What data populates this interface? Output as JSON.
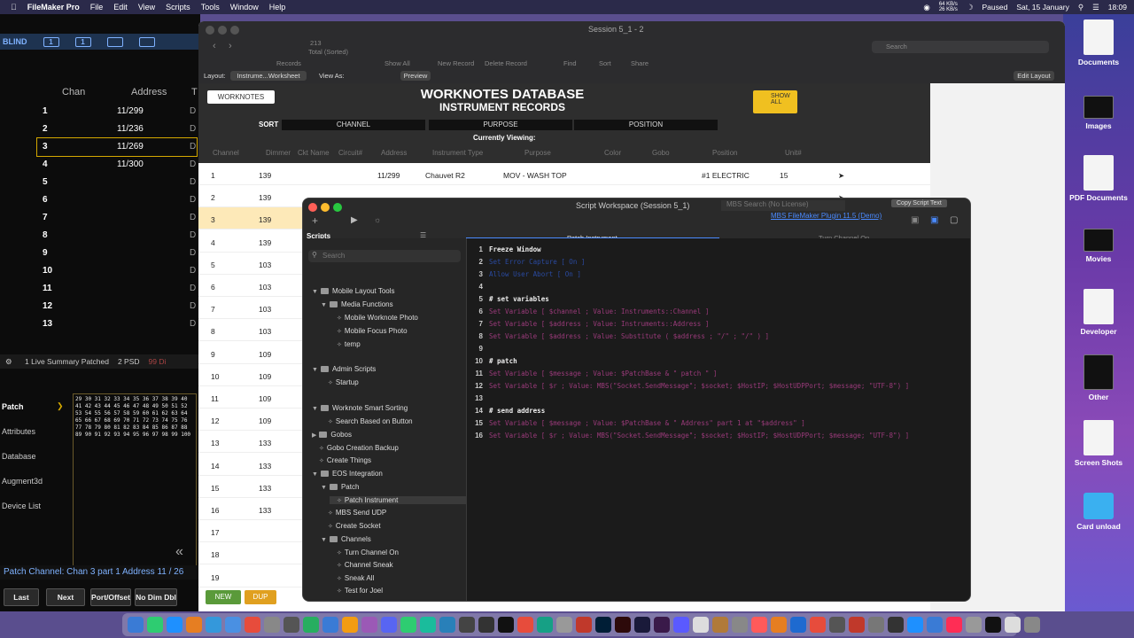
{
  "menubar": {
    "items": [
      "FileMaker Pro",
      "File",
      "Edit",
      "View",
      "Scripts",
      "Tools",
      "Window",
      "Help"
    ],
    "net": "64 KB/s\n26 KB/s",
    "status": "Paused",
    "date": "Sat, 15 January",
    "time": "18:09"
  },
  "desktop": {
    "icons": [
      "Documents",
      "Images",
      "PDF Documents",
      "Movies",
      "Developer",
      "Other",
      "Screen Shots",
      "Card unload"
    ]
  },
  "eos": {
    "mode": "BLIND",
    "blind_buttons": [
      "1",
      "1",
      "",
      ""
    ],
    "col_chan": "Chan",
    "col_address": "Address",
    "col_t": "T",
    "rows": [
      {
        "chan": "1",
        "addr": "11/299"
      },
      {
        "chan": "2",
        "addr": "11/236"
      },
      {
        "chan": "3",
        "addr": "11/269"
      },
      {
        "chan": "4",
        "addr": "11/300"
      },
      {
        "chan": "5",
        "addr": ""
      },
      {
        "chan": "6",
        "addr": ""
      },
      {
        "chan": "7",
        "addr": ""
      },
      {
        "chan": "8",
        "addr": ""
      },
      {
        "chan": "9",
        "addr": ""
      },
      {
        "chan": "10",
        "addr": ""
      },
      {
        "chan": "11",
        "addr": ""
      },
      {
        "chan": "12",
        "addr": ""
      },
      {
        "chan": "13",
        "addr": ""
      }
    ],
    "summary": [
      "1 Live Summary Patched",
      "2 PSD",
      "99 Di"
    ],
    "side_items": [
      "Patch",
      "Attributes",
      "Database",
      "Augment3d",
      "Device List"
    ],
    "command_line": "Patch Channel:  Chan 3 part 1 Address 11 / 26",
    "buttons": [
      "Last",
      "Next",
      "Port/Offset",
      "No Dim Dbl"
    ]
  },
  "fm": {
    "window_title": "Session 5_1 - 2",
    "records": "213",
    "records_sub": "Total (Sorted)",
    "records_label": "Records",
    "toolbar": [
      "Show All",
      "New Record",
      "Delete Record",
      "Find",
      "Sort",
      "Share"
    ],
    "search_placeholder": "Search",
    "layout_label": "Layout:",
    "layout_value": "Instrume...Worksheet",
    "view_as": "View As:",
    "preview": "Preview",
    "edit_layout": "Edit Layout",
    "worknotes_btn": "WORKNOTES",
    "db_title": "WORKNOTES DATABASE",
    "db_subtitle": "INSTRUMENT RECORDS",
    "show_all": "SHOW ALL",
    "sort": "SORT",
    "sort_tabs": [
      "CHANNEL",
      "PURPOSE",
      "POSITION"
    ],
    "currently_viewing": "Currently Viewing:",
    "columns": [
      "Channel",
      "Dimmer",
      "Ckt Name",
      "Circuit#",
      "Address",
      "Instrument Type",
      "Purpose",
      "Color",
      "Gobo",
      "Position",
      "Unit#"
    ],
    "records_list": [
      {
        "ch": "1",
        "dim": "139",
        "addr": "11/299",
        "type": "Chauvet R2",
        "purpose": "MOV - WASH TOP",
        "pos": "#1 ELECTRIC",
        "unit": "15"
      },
      {
        "ch": "2",
        "dim": "139",
        "addr": "",
        "type": "",
        "purpose": "",
        "pos": "",
        "unit": ""
      },
      {
        "ch": "3",
        "dim": "139",
        "addr": "",
        "type": "",
        "purpose": "",
        "pos": "",
        "unit": ""
      },
      {
        "ch": "4",
        "dim": "139"
      },
      {
        "ch": "5",
        "dim": "103"
      },
      {
        "ch": "6",
        "dim": "103"
      },
      {
        "ch": "7",
        "dim": "103"
      },
      {
        "ch": "8",
        "dim": "103"
      },
      {
        "ch": "9",
        "dim": "109"
      },
      {
        "ch": "10",
        "dim": "109"
      },
      {
        "ch": "11",
        "dim": "109"
      },
      {
        "ch": "12",
        "dim": "109"
      },
      {
        "ch": "13",
        "dim": "133"
      },
      {
        "ch": "14",
        "dim": "133"
      },
      {
        "ch": "15",
        "dim": "133"
      },
      {
        "ch": "16",
        "dim": "133"
      },
      {
        "ch": "17",
        "dim": ""
      },
      {
        "ch": "18",
        "dim": ""
      },
      {
        "ch": "19",
        "dim": ""
      }
    ],
    "new_btn": "NEW",
    "dup_btn": "DUP"
  },
  "sw": {
    "title": "Script Workspace (Session 5_1)",
    "mbs_search": "MBS Search (No License)",
    "copy_btn": "Copy Script Text",
    "mbs_plugin": "MBS FileMaker Plugin 11.5 (Demo)",
    "scripts_label": "Scripts",
    "search_placeholder": "Search",
    "tab_active": "Patch Instrument",
    "tab_other": "Turn Channel On",
    "tree": [
      {
        "label": "Mobile Layout Tools",
        "lvl": 0,
        "folder": true,
        "open": true
      },
      {
        "label": "Media Functions",
        "lvl": 1,
        "folder": true,
        "open": true
      },
      {
        "label": "Mobile Worknote Photo",
        "lvl": 2
      },
      {
        "label": "Mobile Focus Photo",
        "lvl": 2
      },
      {
        "label": "temp",
        "lvl": 2
      },
      {
        "label": "Admin Scripts",
        "lvl": 0,
        "folder": true,
        "open": true,
        "gap": true
      },
      {
        "label": "Startup",
        "lvl": 1
      },
      {
        "label": "Worknote Smart Sorting",
        "lvl": 0,
        "folder": true,
        "open": true,
        "gap": true
      },
      {
        "label": "Search Based on Button",
        "lvl": 1
      },
      {
        "label": "Gobos",
        "lvl": 0,
        "folder": true
      },
      {
        "label": "Gobo Creation Backup",
        "lvl": 0
      },
      {
        "label": "Create Things",
        "lvl": 0
      },
      {
        "label": "EOS Integration",
        "lvl": 0,
        "folder": true,
        "open": true
      },
      {
        "label": "Patch",
        "lvl": 1,
        "folder": true,
        "open": true
      },
      {
        "label": "Patch Instrument",
        "lvl": 2,
        "sel": true
      },
      {
        "label": "MBS Send UDP",
        "lvl": 1
      },
      {
        "label": "Create Socket",
        "lvl": 1
      },
      {
        "label": "Channels",
        "lvl": 1,
        "folder": true,
        "open": true
      },
      {
        "label": "Turn Channel On",
        "lvl": 2
      },
      {
        "label": "Channel Sneak",
        "lvl": 2
      },
      {
        "label": "Sneak All",
        "lvl": 2
      },
      {
        "label": "Test for Joel",
        "lvl": 2
      },
      {
        "label": "AV Capture Scripts",
        "lvl": 0,
        "folder": true
      }
    ],
    "code": [
      {
        "n": "1",
        "t": "Freeze Window",
        "k": "cm"
      },
      {
        "n": "2",
        "t": "Set Error Capture [ On ]",
        "k": "bl"
      },
      {
        "n": "3",
        "t": "Allow User Abort [ On ]",
        "k": "bl"
      },
      {
        "n": "4",
        "t": "",
        "k": "cm"
      },
      {
        "n": "5",
        "t": "# set variables",
        "k": "cm"
      },
      {
        "n": "6",
        "t": "Set Variable [ $channel ; Value: Instruments::Channel ]",
        "k": "st"
      },
      {
        "n": "7",
        "t": "Set Variable [ $address ; Value: Instruments::Address ]",
        "k": "st"
      },
      {
        "n": "8",
        "t": "Set Variable [ $address ; Value: Substitute ( $address ; \"/\" ; \"/\" ) ]",
        "k": "st"
      },
      {
        "n": "9",
        "t": "",
        "k": "cm"
      },
      {
        "n": "10",
        "t": "# patch",
        "k": "cm"
      },
      {
        "n": "11",
        "t": "Set Variable [ $message ; Value: $PatchBase & \" patch \" ]",
        "k": "st"
      },
      {
        "n": "12",
        "t": "Set Variable [ $r ; Value: MBS(\"Socket.SendMessage\"; $socket; $HostIP; $HostUDPPort; $message; \"UTF-8\") ]",
        "k": "st"
      },
      {
        "n": "13",
        "t": "",
        "k": "cm"
      },
      {
        "n": "14",
        "t": "# send address",
        "k": "cm"
      },
      {
        "n": "15",
        "t": "Set Variable [ $message ; Value: $PatchBase & \" Address\" part 1 at \"$address\" ]",
        "k": "st"
      },
      {
        "n": "16",
        "t": "Set Variable [ $r ; Value: MBS(\"Socket.SendMessage\"; $socket; $HostIP; $HostUDPPort; $message; \"UTF-8\") ]",
        "k": "st"
      }
    ]
  }
}
